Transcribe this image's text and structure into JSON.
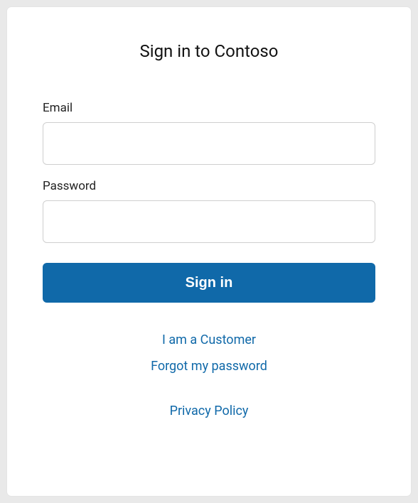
{
  "title": "Sign in to Contoso",
  "form": {
    "email_label": "Email",
    "email_value": "",
    "password_label": "Password",
    "password_value": "",
    "submit_label": "Sign in"
  },
  "links": {
    "customer": "I am a Customer",
    "forgot": "Forgot my password",
    "privacy": "Privacy Policy"
  }
}
